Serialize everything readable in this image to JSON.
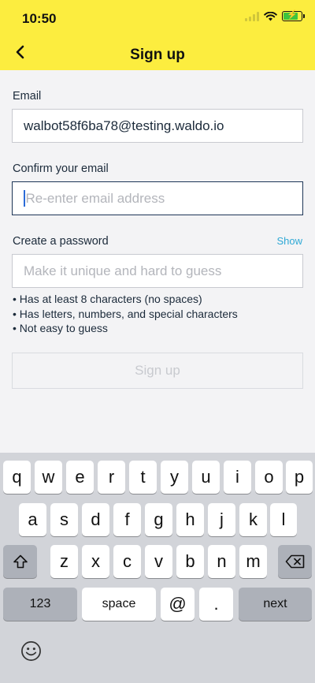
{
  "status": {
    "time": "10:50",
    "battery_level": 0.85
  },
  "header": {
    "title": "Sign up",
    "back_icon": "chevron-left-icon"
  },
  "form": {
    "email_label": "Email",
    "email_value": "walbot58f6ba78@testing.waldo.io",
    "confirm_label": "Confirm your email",
    "confirm_placeholder": "Re-enter email address",
    "password_label": "Create a password",
    "password_show": "Show",
    "password_placeholder": "Make it unique and hard to guess",
    "rules": [
      "• Has at least 8 characters (no spaces)",
      "• Has letters, numbers, and special characters",
      "• Not easy to guess"
    ],
    "signup_label": "Sign up"
  },
  "keyboard": {
    "row1": [
      "q",
      "w",
      "e",
      "r",
      "t",
      "y",
      "u",
      "i",
      "o",
      "p"
    ],
    "row2": [
      "a",
      "s",
      "d",
      "f",
      "g",
      "h",
      "j",
      "k",
      "l"
    ],
    "row3": [
      "z",
      "x",
      "c",
      "v",
      "b",
      "n",
      "m"
    ],
    "numbers": "123",
    "space": "space",
    "at": "@",
    "dot": ".",
    "next": "next"
  }
}
